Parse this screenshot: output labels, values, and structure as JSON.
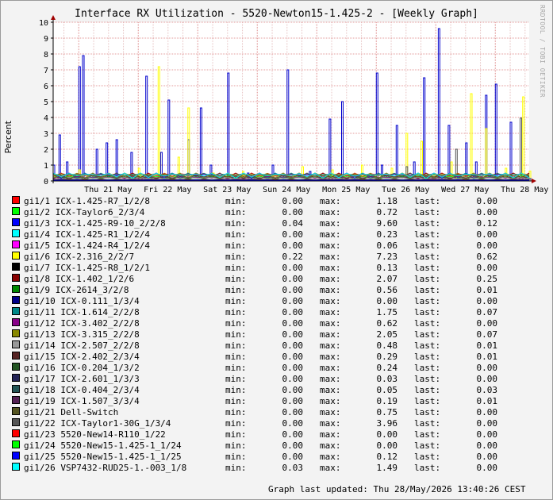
{
  "title": "Interface RX Utilization - 5520-Newton15-1.425-2 - [Weekly Graph]",
  "watermark": "RRDTOOL / TOBI OETIKER",
  "ylabel": "Percent",
  "updated_label": "Graph last updated:",
  "updated_value": "Thu 28/May/2026 13:40:26 CEST",
  "colors": {
    "background": "#f3f3f3",
    "plot_bg": "#ffffff",
    "grid_major": "#e39a9a",
    "grid_minor": "#e7c4c4",
    "axis": "#000000"
  },
  "chart_data": {
    "type": "line",
    "title": "Interface RX Utilization - 5520-Newton15-1.425-2 - [Weekly Graph]",
    "ylabel": "Percent",
    "xlabel": "",
    "ylim": [
      0,
      10
    ],
    "yticks": [
      "0",
      "1",
      "2",
      "3",
      "4",
      "5",
      "6",
      "7",
      "8",
      "9",
      "10"
    ],
    "xlim": [
      "2026-05-20T13:40",
      "2026-05-28T13:40"
    ],
    "x_tick_labels": [
      "Thu 21 May",
      "Fri 22 May",
      "Sat 23 May",
      "Sun 24 May",
      "Mon 25 May",
      "Tue 26 May",
      "Wed 27 May",
      "Thu 28 May"
    ],
    "x_tick_dates": [
      "2026-05-21",
      "2026-05-22",
      "2026-05-23",
      "2026-05-24",
      "2026-05-25",
      "2026-05-26",
      "2026-05-27",
      "2026-05-28"
    ],
    "grid": true,
    "legend": "bottom",
    "highlight_series": [
      {
        "name": "gi1/3",
        "color": "#0000cc",
        "x": [
          "2026-05-20T13:40",
          "2026-05-20T16:00",
          "2026-05-20T19:00",
          "2026-05-21T00:00",
          "2026-05-21T01:30",
          "2026-05-21T07:00",
          "2026-05-21T11:00",
          "2026-05-21T15:00",
          "2026-05-21T21:00",
          "2026-05-22T03:00",
          "2026-05-22T09:00",
          "2026-05-22T12:00",
          "2026-05-22T20:00",
          "2026-05-23T01:00",
          "2026-05-23T05:00",
          "2026-05-23T12:00",
          "2026-05-23T20:00",
          "2026-05-24T06:00",
          "2026-05-24T12:00",
          "2026-05-24T21:00",
          "2026-05-25T05:00",
          "2026-05-25T10:00",
          "2026-05-25T17:00",
          "2026-05-26T00:00",
          "2026-05-26T02:00",
          "2026-05-26T08:00",
          "2026-05-26T15:00",
          "2026-05-26T19:00",
          "2026-05-27T01:00",
          "2026-05-27T05:00",
          "2026-05-27T12:00",
          "2026-05-27T16:00",
          "2026-05-27T20:00",
          "2026-05-28T00:00",
          "2026-05-28T06:00",
          "2026-05-28T13:40"
        ],
        "y": [
          1.0,
          2.9,
          1.2,
          7.2,
          7.9,
          2.0,
          2.4,
          2.6,
          1.8,
          6.6,
          1.8,
          5.1,
          2.6,
          4.6,
          1.0,
          6.8,
          0.5,
          1.0,
          7.0,
          0.6,
          3.9,
          5.0,
          0.3,
          6.8,
          1.0,
          3.5,
          1.2,
          6.5,
          9.6,
          3.5,
          2.4,
          1.2,
          5.4,
          6.1,
          3.7,
          0.12
        ]
      },
      {
        "name": "gi1/6",
        "color": "#ffff00",
        "x": [
          "2026-05-20T13:40",
          "2026-05-21T00:00",
          "2026-05-21T12:00",
          "2026-05-22T00:00",
          "2026-05-22T08:00",
          "2026-05-22T16:00",
          "2026-05-22T20:00",
          "2026-05-23T06:00",
          "2026-05-23T18:00",
          "2026-05-24T06:00",
          "2026-05-24T18:00",
          "2026-05-25T06:00",
          "2026-05-25T18:00",
          "2026-05-26T06:00",
          "2026-05-26T12:00",
          "2026-05-26T18:00",
          "2026-05-27T06:00",
          "2026-05-27T14:00",
          "2026-05-27T20:00",
          "2026-05-28T04:00",
          "2026-05-28T11:00",
          "2026-05-28T13:40"
        ],
        "y": [
          0.3,
          0.7,
          0.4,
          0.8,
          7.2,
          1.5,
          4.6,
          0.5,
          0.6,
          0.4,
          0.9,
          0.7,
          1.0,
          0.8,
          3.0,
          2.5,
          1.2,
          5.5,
          3.3,
          0.8,
          5.3,
          0.62
        ]
      },
      {
        "name": "gi1/22",
        "color": "#555555",
        "x": [
          "2026-05-20T13:40",
          "2026-05-26T12:00",
          "2026-05-27T08:00",
          "2026-05-28T10:00",
          "2026-05-28T13:40"
        ],
        "y": [
          0.2,
          0.9,
          2.0,
          3.96,
          0.0
        ]
      }
    ],
    "series": [
      {
        "name": "gi1/1",
        "label": "ICX-1.425-R7_1/2/8",
        "color": "#ff0000",
        "min": "0.00",
        "max": "1.18",
        "last": "0.00"
      },
      {
        "name": "gi1/2",
        "label": "ICX-Taylor6_2/3/4",
        "color": "#00ff00",
        "min": "0.00",
        "max": "0.72",
        "last": "0.00"
      },
      {
        "name": "gi1/3",
        "label": "ICX-1.425-R9-10_2/2/8",
        "color": "#0000ff",
        "min": "0.04",
        "max": "9.60",
        "last": "0.12"
      },
      {
        "name": "gi1/4",
        "label": "ICX-1.425-R1_1/2/4",
        "color": "#00ffff",
        "min": "0.00",
        "max": "0.23",
        "last": "0.00"
      },
      {
        "name": "gi1/5",
        "label": "ICX-1.424-R4_1/2/4",
        "color": "#ff00ff",
        "min": "0.00",
        "max": "0.06",
        "last": "0.00"
      },
      {
        "name": "gi1/6",
        "label": "ICX-2.316_2/2/7",
        "color": "#ffff00",
        "min": "0.22",
        "max": "7.23",
        "last": "0.62"
      },
      {
        "name": "gi1/7",
        "label": "ICX-1.425-R8_1/2/1",
        "color": "#000000",
        "min": "0.00",
        "max": "0.13",
        "last": "0.00"
      },
      {
        "name": "gi1/8",
        "label": "ICX-1.402_1/2/6",
        "color": "#880000",
        "min": "0.00",
        "max": "2.07",
        "last": "0.25"
      },
      {
        "name": "gi1/9",
        "label": "ICX-2614_3/2/8",
        "color": "#008800",
        "min": "0.00",
        "max": "0.56",
        "last": "0.01"
      },
      {
        "name": "gi1/10",
        "label": "ICX-0.111_1/3/4",
        "color": "#000088",
        "min": "0.00",
        "max": "0.00",
        "last": "0.00"
      },
      {
        "name": "gi1/11",
        "label": "ICX-1.614_2/2/8",
        "color": "#008888",
        "min": "0.00",
        "max": "1.75",
        "last": "0.07"
      },
      {
        "name": "gi1/12",
        "label": "ICX-3.402_2/2/8",
        "color": "#880088",
        "min": "0.00",
        "max": "0.62",
        "last": "0.00"
      },
      {
        "name": "gi1/13",
        "label": "ICX-3.315_2/2/8",
        "color": "#888800",
        "min": "0.00",
        "max": "2.05",
        "last": "0.07"
      },
      {
        "name": "gi1/14",
        "label": "ICX-2.507_2/2/8",
        "color": "#999999",
        "min": "0.00",
        "max": "0.48",
        "last": "0.01"
      },
      {
        "name": "gi1/15",
        "label": "ICX-2.402_2/3/4",
        "color": "#552222",
        "min": "0.00",
        "max": "0.29",
        "last": "0.01"
      },
      {
        "name": "gi1/16",
        "label": "ICX-0.204_1/3/2",
        "color": "#225522",
        "min": "0.00",
        "max": "0.24",
        "last": "0.00"
      },
      {
        "name": "gi1/17",
        "label": "ICX-2.601_1/3/3",
        "color": "#222255",
        "min": "0.00",
        "max": "0.03",
        "last": "0.00"
      },
      {
        "name": "gi1/18",
        "label": "ICX-0.404_2/3/4",
        "color": "#225555",
        "min": "0.00",
        "max": "0.05",
        "last": "0.03"
      },
      {
        "name": "gi1/19",
        "label": "ICX-1.507_3/3/4",
        "color": "#552255",
        "min": "0.00",
        "max": "0.19",
        "last": "0.01"
      },
      {
        "name": "gi1/21",
        "label": "Dell-Switch",
        "color": "#555522",
        "min": "0.00",
        "max": "0.75",
        "last": "0.00"
      },
      {
        "name": "gi1/22",
        "label": "ICX-Taylor1-30G_1/3/4",
        "color": "#555555",
        "min": "0.00",
        "max": "3.96",
        "last": "0.00"
      },
      {
        "name": "gi1/23",
        "label": "5520-New14-R110_1/22",
        "color": "#ff0000",
        "min": "0.00",
        "max": "0.00",
        "last": "0.00"
      },
      {
        "name": "gi1/24",
        "label": "5520-New15-1.425-1_1/24",
        "color": "#00ff00",
        "min": "0.00",
        "max": "0.00",
        "last": "0.00"
      },
      {
        "name": "gi1/25",
        "label": "5520-New15-1.425-1_1/25",
        "color": "#0000ff",
        "min": "0.00",
        "max": "0.12",
        "last": "0.00"
      },
      {
        "name": "gi1/26",
        "label": "VSP7432-RUD25-1.-003_1/8",
        "color": "#00ffff",
        "min": "0.03",
        "max": "1.49",
        "last": "0.00"
      }
    ],
    "stat_labels": {
      "min": "min:",
      "max": "max:",
      "last": "last:"
    }
  }
}
